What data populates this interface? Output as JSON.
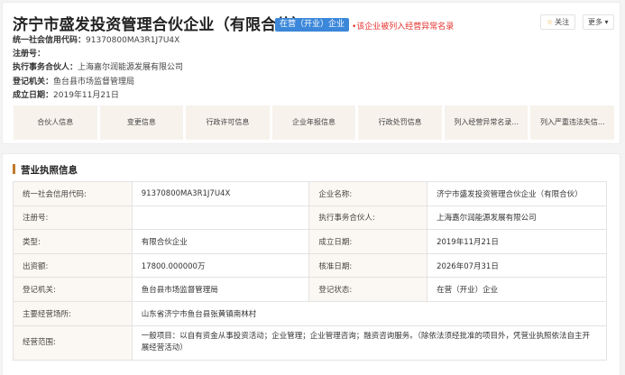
{
  "company": {
    "name": "济宁市盛发投资管理合伙企业（有限合伙）",
    "status": "在营（开业）企业",
    "abnormal_note": "•该企业被列入经营异常名录"
  },
  "actions": {
    "follow_icon": "star-icon",
    "follow": "关注",
    "more": "更多 ▾"
  },
  "basic": [
    {
      "key": "统一社会信用代码：",
      "value": "91370800MA3R1J7U4X"
    },
    {
      "key": "注册号：",
      "value": ""
    },
    {
      "key": "执行事务合伙人：",
      "value": "上海嘉尔润能源发展有限公司"
    },
    {
      "key": "登记机关：",
      "value": "鱼台县市场监督管理局"
    },
    {
      "key": "成立日期：",
      "value": "2019年11月21日"
    }
  ],
  "tabs": [
    "合伙人信息",
    "变更信息",
    "行政许可信息",
    "企业年报信息",
    "行政处罚信息",
    "列入经营异常名录...",
    "列入严重违法失信..."
  ],
  "license": {
    "title": "营业执照信息",
    "rows": [
      [
        "统一社会信用代码:",
        "91370800MA3R1J7U4X",
        "企业名称:",
        "济宁市盛发投资管理合伙企业（有限合伙）"
      ],
      [
        "注册号:",
        "",
        "执行事务合伙人:",
        "上海嘉尔润能源发展有限公司"
      ],
      [
        "类型:",
        "有限合伙企业",
        "成立日期:",
        "2019年11月21日"
      ],
      [
        "出资额:",
        "17800.000000万",
        "核准日期:",
        "2026年07月31日"
      ],
      [
        "登记机关:",
        "鱼台县市场监督管理局",
        "登记状态:",
        "在营（开业）企业"
      ]
    ],
    "address": [
      "主要经营场所:",
      "山东省济宁市鱼台县张黄镇南林村"
    ],
    "scope": [
      "经营范围:",
      "一般项目：以自有资金从事投资活动；企业管理；企业管理咨询；融资咨询服务。（除依法须经批准的项目外，凭营业执照依法自主开展经营活动）"
    ]
  },
  "colors": {
    "badge": "#3b87d9",
    "warning": "#e5322d",
    "accent": "#c07a2a",
    "tab_bg": "#f7f2ec"
  }
}
